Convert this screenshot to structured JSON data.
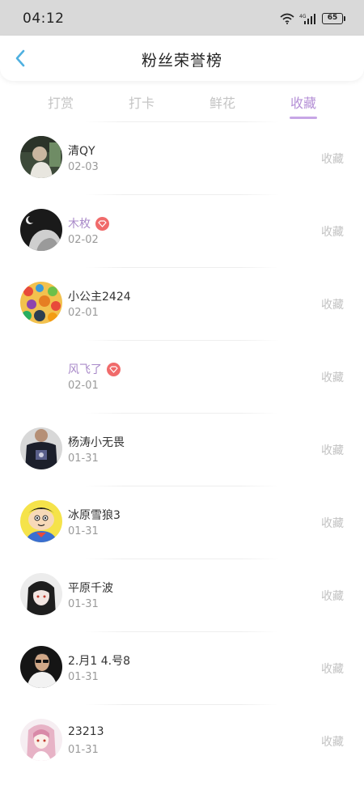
{
  "status_bar": {
    "time": "04:12",
    "battery": "65"
  },
  "header": {
    "title": "粉丝荣誉榜"
  },
  "tabs": [
    {
      "label": "打赏",
      "active": false
    },
    {
      "label": "打卡",
      "active": false
    },
    {
      "label": "鲜花",
      "active": false
    },
    {
      "label": "收藏",
      "active": true
    }
  ],
  "colors": {
    "accent": "#b48fd6",
    "vip_name": "#a98ac9",
    "vip_badge": "#f06b6b"
  },
  "rows": [
    {
      "name": "清QY",
      "date": "02-03",
      "type": "收藏",
      "vip": false,
      "avatar": "photo-avatar"
    },
    {
      "name": "木枚",
      "date": "02-02",
      "type": "收藏",
      "vip": true,
      "avatar": "dark-art-avatar"
    },
    {
      "name": "小公主2424",
      "date": "02-01",
      "type": "收藏",
      "vip": false,
      "avatar": "candy-avatar"
    },
    {
      "name": "风飞了",
      "date": "02-01",
      "type": "收藏",
      "vip": true,
      "avatar": "blank-avatar"
    },
    {
      "name": "杨涛小无畏",
      "date": "01-31",
      "type": "收藏",
      "vip": false,
      "avatar": "tshirt-avatar"
    },
    {
      "name": "冰原雪狼3",
      "date": "01-31",
      "type": "收藏",
      "vip": false,
      "avatar": "cartoon-avatar"
    },
    {
      "name": "平原千波",
      "date": "01-31",
      "type": "收藏",
      "vip": false,
      "avatar": "anime-avatar"
    },
    {
      "name": "2.月1 4.号8",
      "date": "01-31",
      "type": "收藏",
      "vip": false,
      "avatar": "sunglasses-avatar"
    },
    {
      "name": "23213",
      "date": "01-31",
      "type": "收藏",
      "vip": false,
      "avatar": "pink-anime-avatar"
    }
  ]
}
